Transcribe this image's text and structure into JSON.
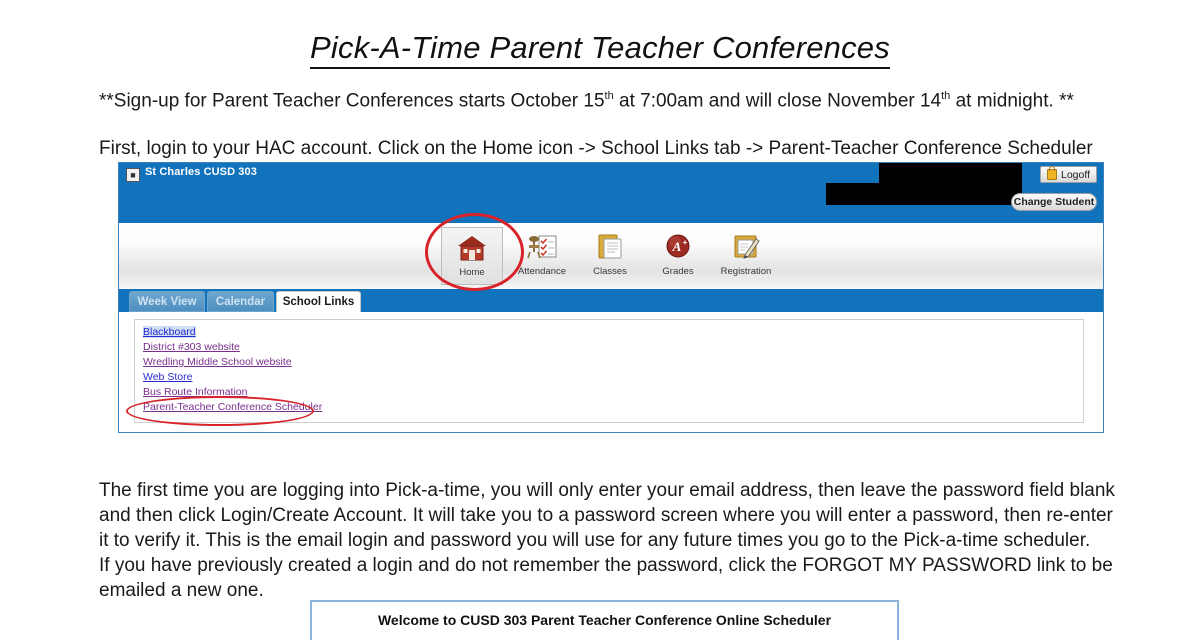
{
  "document": {
    "title": "Pick-A-Time Parent Teacher Conferences",
    "signup_notice_parts": {
      "a": "**Sign-up for Parent Teacher Conferences starts October 15",
      "sup1": "th",
      "b": " at 7:00am and will close November 14",
      "sup2": "th",
      "c": " at midnight. **"
    },
    "instruction_line": "First, login to your HAC account. Click on the Home icon -> School Links tab -> Parent-Teacher Conference Scheduler",
    "body_paragraph_lines": [
      "The first time you are logging into Pick-a-time, you will only enter your email address, then leave the password field blank",
      "and then click Login/Create Account. It will take you to a password screen where you will enter a password, then re-enter",
      "it to verify it. This is the email login and password you will use for any future times you go to the Pick-a-time scheduler.",
      "If you have previously created a login and do not remember the password, click the FORGOT MY PASSWORD link to be",
      "emailed a new one."
    ]
  },
  "hac_screenshot": {
    "header": {
      "district_name": "St Charles CUSD 303",
      "logo_icon": "broken-image-icon",
      "logoff_button": "Logoff",
      "logoff_icon": "lock-icon",
      "change_student_button": "Change Student",
      "redaction_note": "student name redacted"
    },
    "nav_icons": [
      {
        "label": "Home",
        "icon": "house-icon",
        "selected": true
      },
      {
        "label": "Attendance",
        "icon": "clipboard-checklist-icon",
        "selected": false
      },
      {
        "label": "Classes",
        "icon": "notebook-icon",
        "selected": false
      },
      {
        "label": "Grades",
        "icon": "grade-a-plus-icon",
        "selected": false
      },
      {
        "label": "Registration",
        "icon": "form-pencil-icon",
        "selected": false
      }
    ],
    "tabs": [
      {
        "label": "Week View",
        "active": false
      },
      {
        "label": "Calendar",
        "active": false
      },
      {
        "label": "School Links",
        "active": true
      }
    ],
    "school_links": [
      {
        "label": "Blackboard",
        "state": "selected"
      },
      {
        "label": "District #303 website",
        "state": "visited"
      },
      {
        "label": "Wredling Middle School website",
        "state": "visited"
      },
      {
        "label": "Web Store",
        "state": "link"
      },
      {
        "label": "Bus Route Information",
        "state": "visited"
      },
      {
        "label": "Parent-Teacher Conference Scheduler",
        "state": "visited"
      }
    ],
    "annotations": [
      {
        "name": "home-icon-circle",
        "target": "Home"
      },
      {
        "name": "scheduler-link-circle",
        "target": "Parent-Teacher Conference Scheduler"
      }
    ]
  },
  "welcome_panel": {
    "heading": "Welcome to CUSD 303 Parent Teacher Conference Online Scheduler"
  },
  "colors": {
    "hac_blue": "#1273bd",
    "annotation_red": "#d8232a",
    "link_blue": "#2a2ad0",
    "link_visited": "#7b2f8f",
    "panel_border_blue": "#8ab4dc"
  }
}
